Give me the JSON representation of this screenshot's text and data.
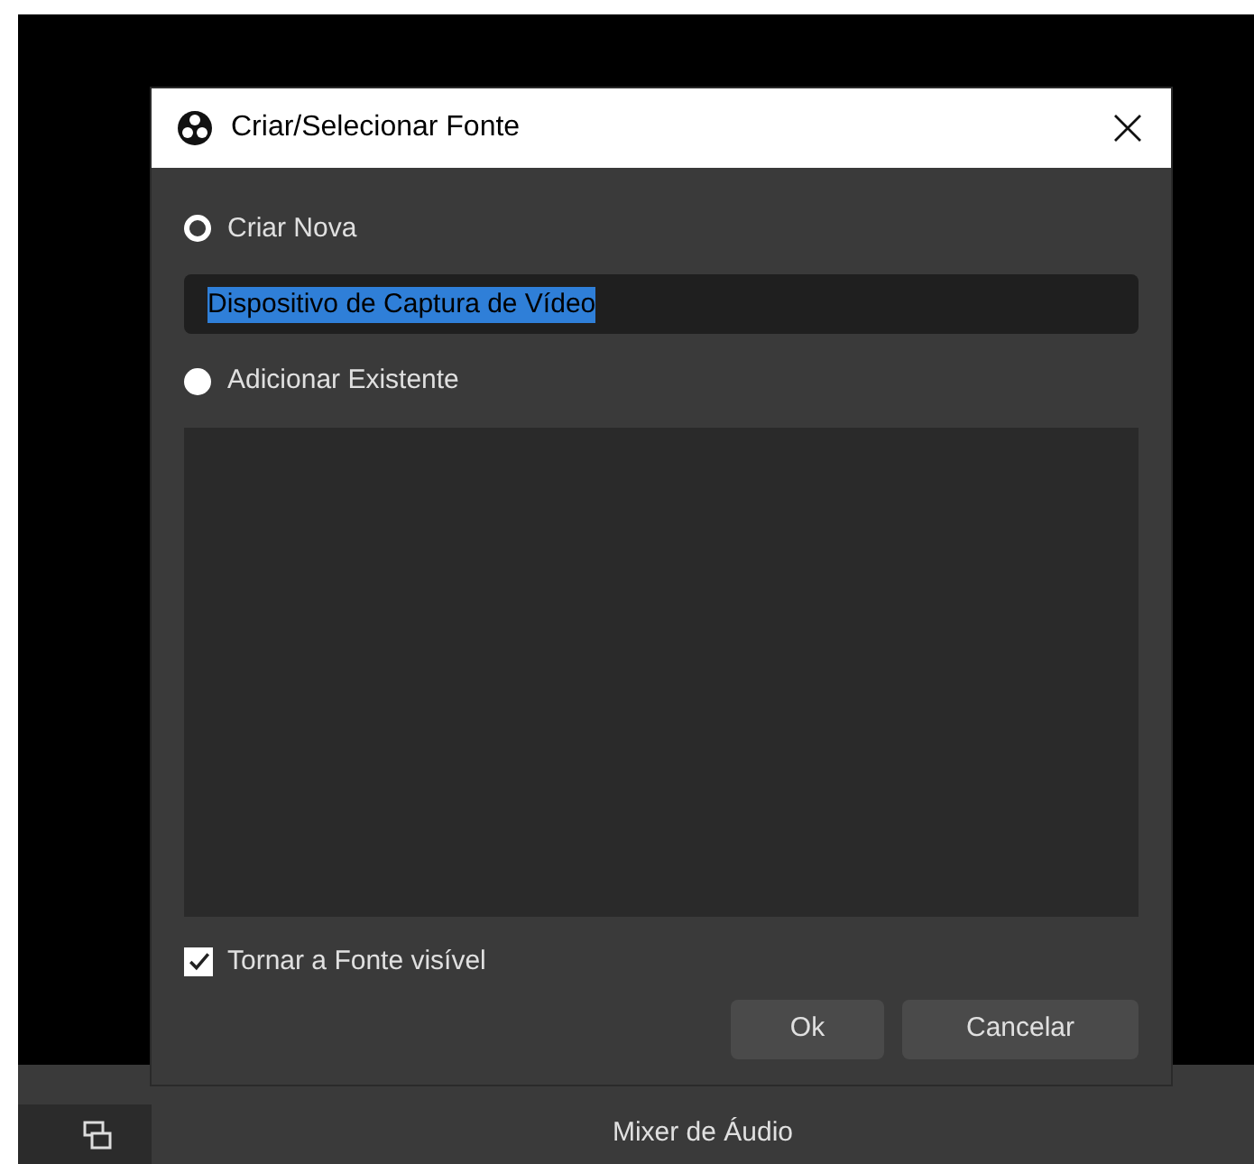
{
  "dialog": {
    "title": "Criar/Selecionar Fonte",
    "options": [
      {
        "label": "Criar Nova",
        "selected": true
      },
      {
        "label": "Adicionar Existente",
        "selected": false
      }
    ],
    "name_field": {
      "value": "Dispositivo de Captura de Vídeo"
    },
    "visible_checkbox": {
      "label": "Tornar a Fonte visível",
      "checked": true
    },
    "buttons": [
      "Ok",
      "Cancelar"
    ]
  },
  "dock": {
    "title": "Mixer de Áudio"
  }
}
